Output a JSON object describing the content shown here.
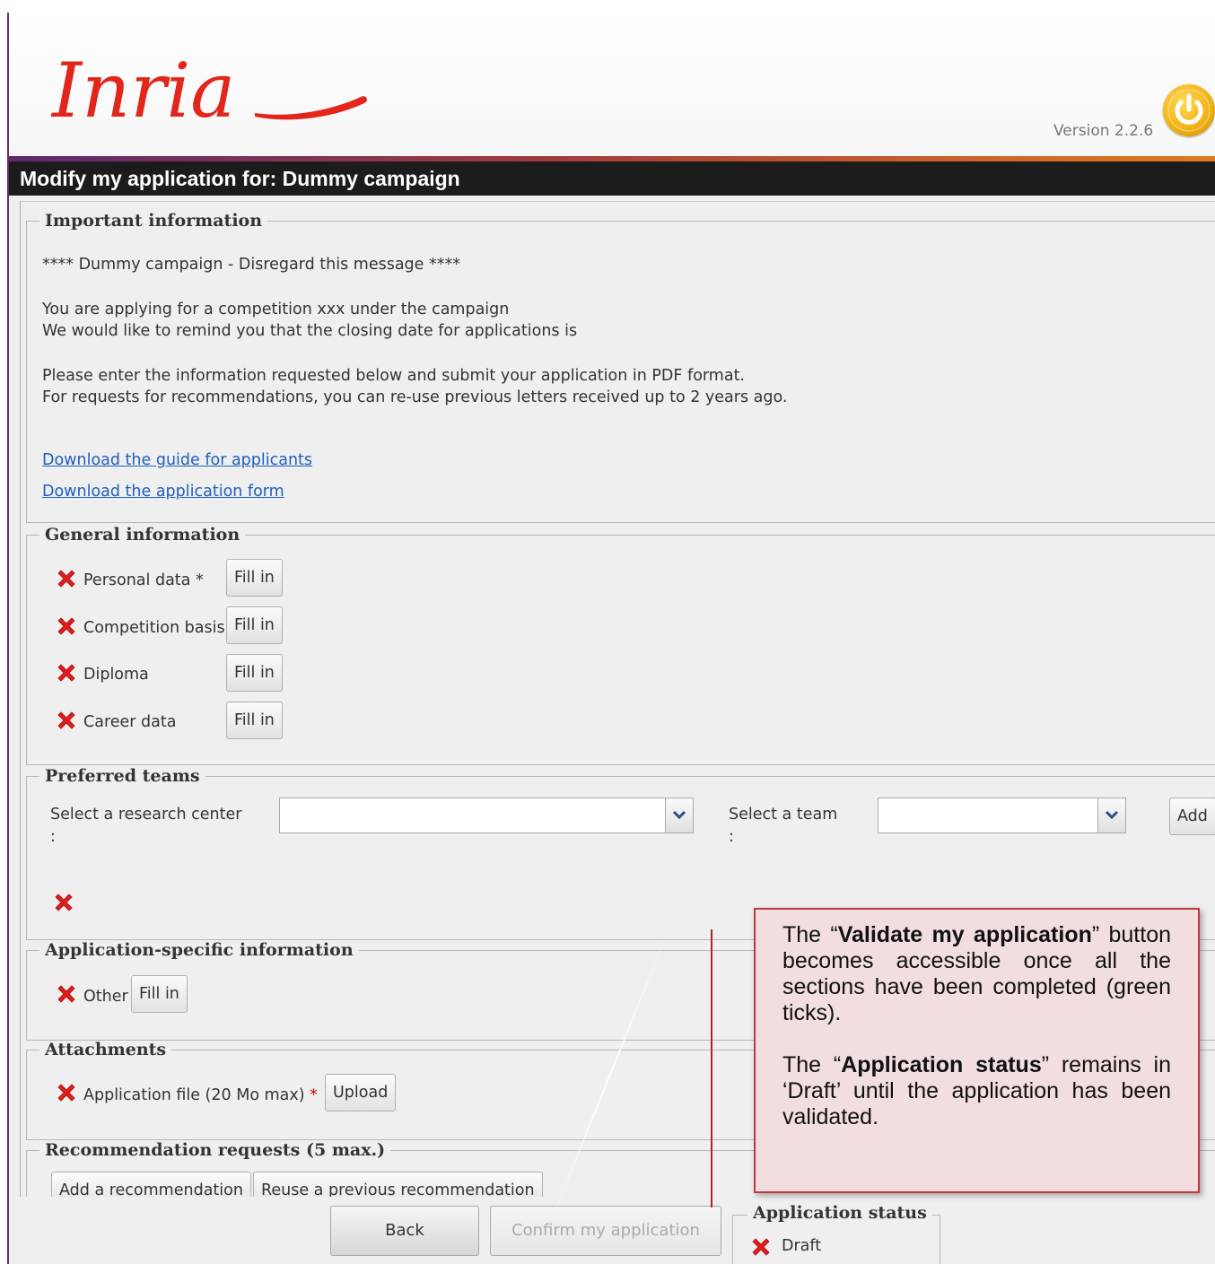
{
  "header": {
    "logo_text": "Inria",
    "version": "Version 2.2.6",
    "logout_icon": "power-icon",
    "brand_color": "#e2261b"
  },
  "page": {
    "title": "Modify my application for: Dummy campaign"
  },
  "important": {
    "legend": "Important information",
    "line1": "**** Dummy campaign - Disregard this message ****",
    "line2": "You are applying for a competition xxx under the campaign",
    "line3": "We would like to remind you that the closing date for applications is",
    "line4": "Please enter the information requested below and submit your application in PDF format.",
    "line5": "For requests for recommendations, you can re-use previous letters received up to 2 years ago.",
    "link1": "Download the guide for applicants",
    "link2": "Download the application form"
  },
  "general": {
    "legend": "General information",
    "items": [
      {
        "label": "Personal data",
        "required": "*",
        "button": "Fill in"
      },
      {
        "label": "Competition basis",
        "button": "Fill in"
      },
      {
        "label": "Diploma",
        "button": "Fill in"
      },
      {
        "label": "Career data",
        "button": "Fill in"
      }
    ]
  },
  "teams": {
    "legend": "Preferred teams",
    "center_label": "Select a research center",
    "center_colon": ":",
    "team_label": "Select a team",
    "team_colon": ":",
    "add_button": "Add"
  },
  "specific": {
    "legend": "Application-specific information",
    "item_label": "Other",
    "button": "Fill in"
  },
  "attachments": {
    "legend": "Attachments",
    "item_label": "Application file (20 Mo max)",
    "required": "*",
    "button": "Upload"
  },
  "recommendations": {
    "legend": "Recommendation requests (5 max.)",
    "add_button": "Add a recommendation",
    "reuse_button": "Reuse a previous recommendation"
  },
  "footer": {
    "back_button": "Back",
    "confirm_button": "Confirm my application"
  },
  "status": {
    "legend": "Application status",
    "value": "Draft"
  },
  "callout": {
    "p1_pre": "The “",
    "p1_bold": "Validate my application",
    "p1_post": "” button becomes accessible once all the sections have been completed (green ticks).",
    "p2_pre": "The “",
    "p2_bold": "Application status",
    "p2_post": "” remains in ‘Draft’ until the application has been validated."
  }
}
